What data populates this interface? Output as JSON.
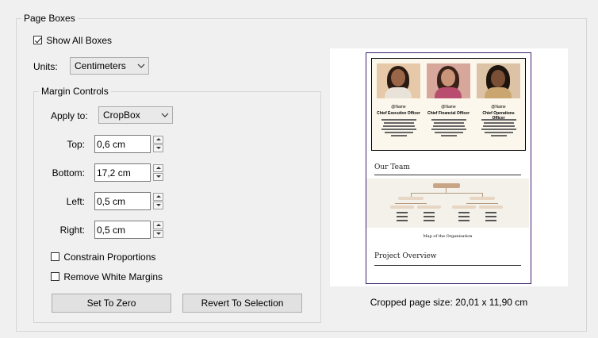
{
  "page_boxes": {
    "legend": "Page Boxes",
    "show_all_boxes": {
      "label": "Show All Boxes",
      "checked": true
    },
    "units": {
      "label": "Units:",
      "value": "Centimeters"
    },
    "margin_controls": {
      "legend": "Margin Controls",
      "apply_to": {
        "label": "Apply to:",
        "value": "CropBox"
      },
      "top": {
        "label": "Top:",
        "value": "0,6 cm"
      },
      "bottom": {
        "label": "Bottom:",
        "value": "17,2 cm"
      },
      "left": {
        "label": "Left:",
        "value": "0,5 cm"
      },
      "right": {
        "label": "Right:",
        "value": "0,5 cm"
      },
      "constrain_proportions": {
        "label": "Constrain Proportions",
        "checked": false
      },
      "remove_white_margins": {
        "label": "Remove White Margins",
        "checked": false
      },
      "set_to_zero_label": "Set To Zero",
      "revert_to_selection_label": "Revert To Selection"
    }
  },
  "preview": {
    "team": [
      {
        "name": "@Name",
        "role": "Chief Executive Officer"
      },
      {
        "name": "@Name",
        "role": "Chief Financial Officer"
      },
      {
        "name": "@Name",
        "role": "Chief Operations Officer"
      }
    ],
    "our_team_heading": "Our Team",
    "org_caption": "Map of the Organisation",
    "project_overview_heading": "Project Overview",
    "crop_border_color": "#3a1f6e"
  },
  "cropped_size_text": "Cropped page size: 20,01 x 11,90 cm"
}
